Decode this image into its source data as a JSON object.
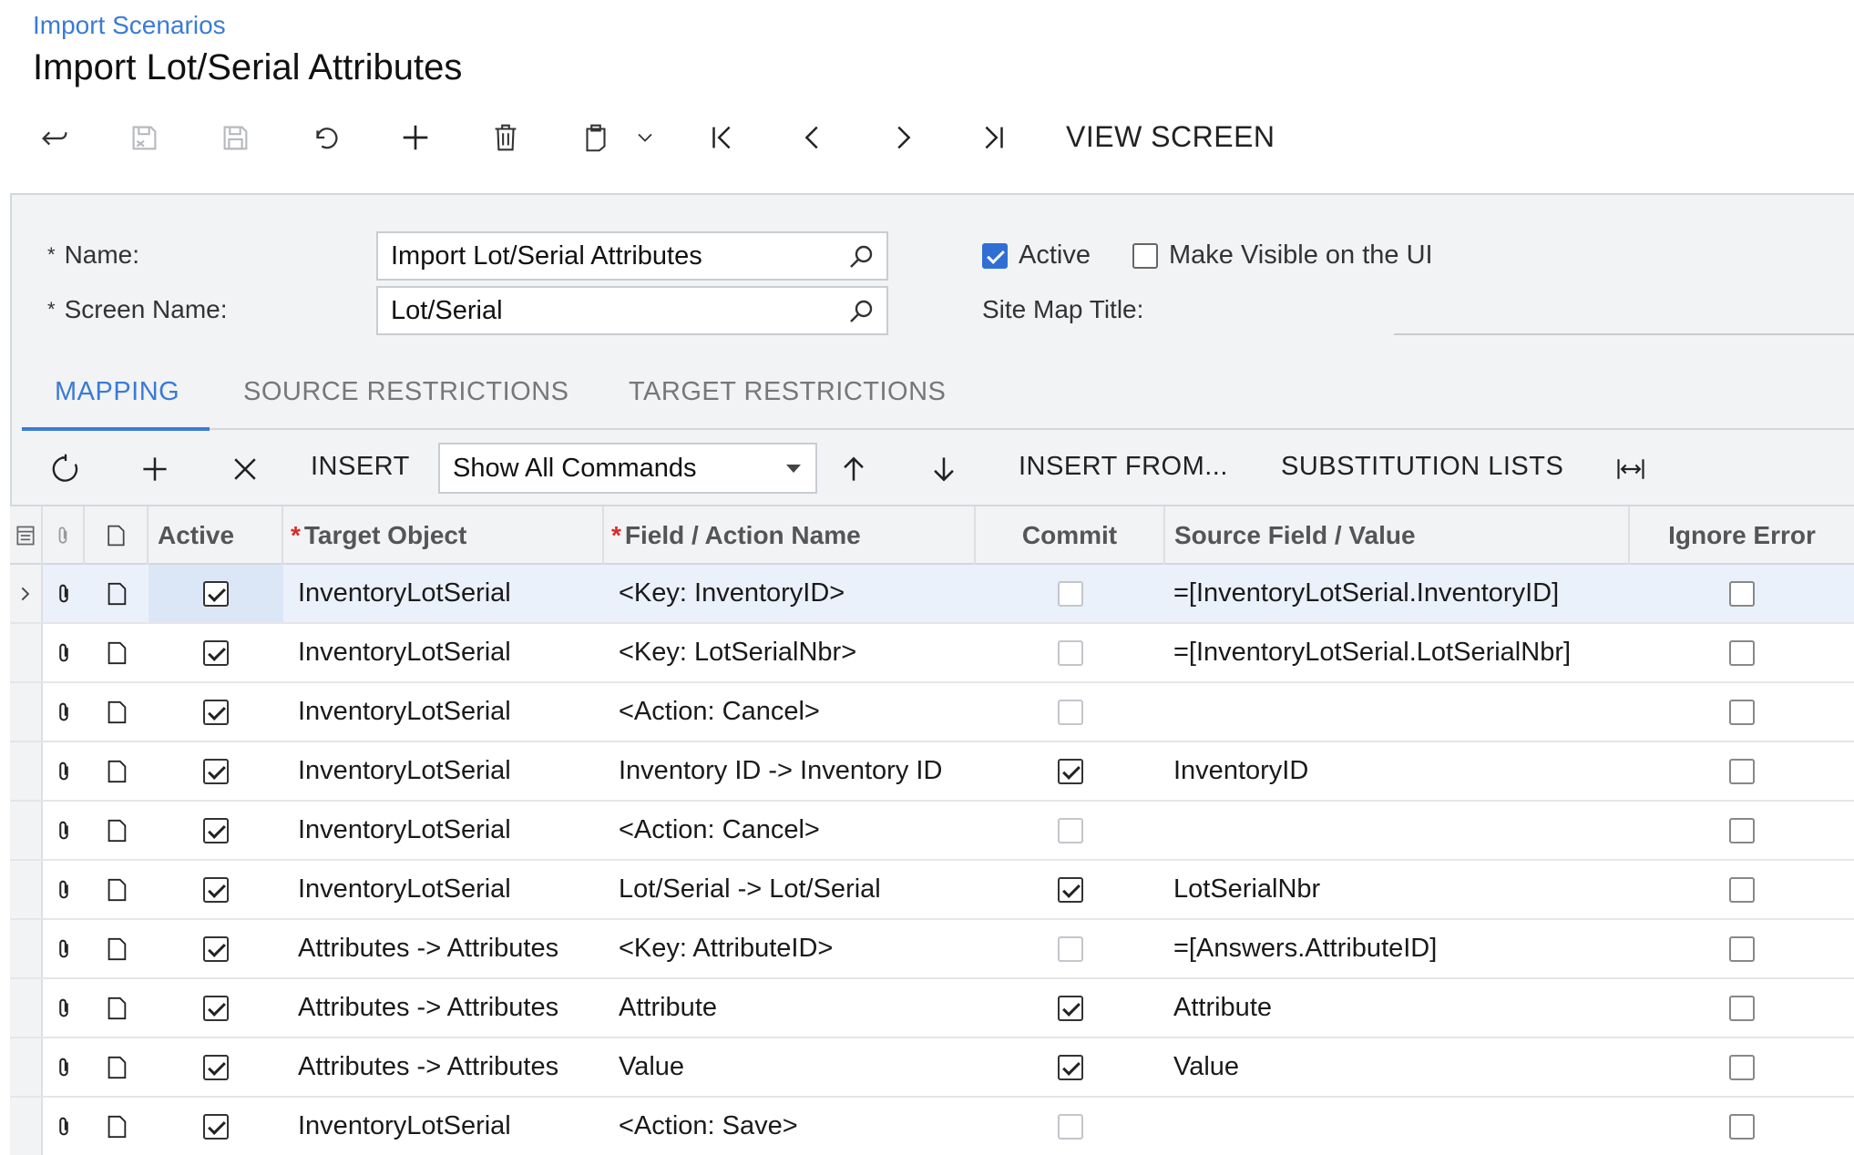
{
  "header": {
    "breadcrumb": "Import Scenarios",
    "title": "Import Lot/Serial Attributes",
    "view_screen": "VIEW SCREEN"
  },
  "toolbar": {
    "icons": [
      "back-icon",
      "save-close-icon",
      "save-icon",
      "undo-icon",
      "add-icon",
      "delete-icon",
      "copy-paste-icon",
      "chevron-down-icon",
      "first-record-icon",
      "previous-record-icon",
      "next-record-icon",
      "last-record-icon"
    ]
  },
  "form": {
    "name_label": "Name:",
    "name_value": "Import Lot/Serial Attributes",
    "screen_label": "Screen Name:",
    "screen_value": "Lot/Serial",
    "active_label": "Active",
    "active_checked": true,
    "visible_label": "Make Visible on the UI",
    "visible_checked": false,
    "sitemap_label": "Site Map Title:",
    "required_mark": "*"
  },
  "tabs": [
    {
      "label": "MAPPING",
      "active": true
    },
    {
      "label": "SOURCE RESTRICTIONS",
      "active": false
    },
    {
      "label": "TARGET RESTRICTIONS",
      "active": false
    }
  ],
  "grid_toolbar": {
    "insert": "INSERT",
    "commands_select": "Show All Commands",
    "insert_from": "INSERT FROM...",
    "substitution_lists": "SUBSTITUTION LISTS"
  },
  "grid": {
    "columns": {
      "active": "Active",
      "target_object": "Target Object",
      "field_action": "Field / Action Name",
      "commit": "Commit",
      "source_field": "Source Field / Value",
      "ignore_error": "Ignore Error",
      "required_mark": "*"
    },
    "rows": [
      {
        "active": true,
        "target": "InventoryLotSerial",
        "field": "<Key: InventoryID>",
        "commit": false,
        "source": "=[InventoryLotSerial.InventoryID]",
        "ignore": false,
        "selected": true
      },
      {
        "active": true,
        "target": "InventoryLotSerial",
        "field": "<Key: LotSerialNbr>",
        "commit": false,
        "source": "=[InventoryLotSerial.LotSerialNbr]",
        "ignore": false
      },
      {
        "active": true,
        "target": "InventoryLotSerial",
        "field": "<Action: Cancel>",
        "commit": false,
        "source": "",
        "ignore": false
      },
      {
        "active": true,
        "target": "InventoryLotSerial",
        "field": "Inventory ID -> Inventory ID",
        "commit": true,
        "source": "InventoryID",
        "ignore": false
      },
      {
        "active": true,
        "target": "InventoryLotSerial",
        "field": "<Action: Cancel>",
        "commit": false,
        "source": "",
        "ignore": false
      },
      {
        "active": true,
        "target": "InventoryLotSerial",
        "field": "Lot/Serial -> Lot/Serial",
        "commit": true,
        "source": "LotSerialNbr",
        "ignore": false
      },
      {
        "active": true,
        "target": "Attributes -> Attributes",
        "field": "<Key: AttributeID>",
        "commit": false,
        "source": "=[Answers.AttributeID]",
        "ignore": false
      },
      {
        "active": true,
        "target": "Attributes -> Attributes",
        "field": "Attribute",
        "commit": true,
        "source": "Attribute",
        "ignore": false
      },
      {
        "active": true,
        "target": "Attributes -> Attributes",
        "field": "Value",
        "commit": true,
        "source": "Value",
        "ignore": false
      },
      {
        "active": true,
        "target": "InventoryLotSerial",
        "field": "<Action: Save>",
        "commit": false,
        "source": "",
        "ignore": false
      }
    ]
  },
  "colors": {
    "link": "#3a7bd5",
    "panel_bg": "#f2f3f5",
    "selected_row": "#eaf1fb",
    "required": "#d92b2b",
    "checkbox_blue": "#2f6fd3"
  }
}
